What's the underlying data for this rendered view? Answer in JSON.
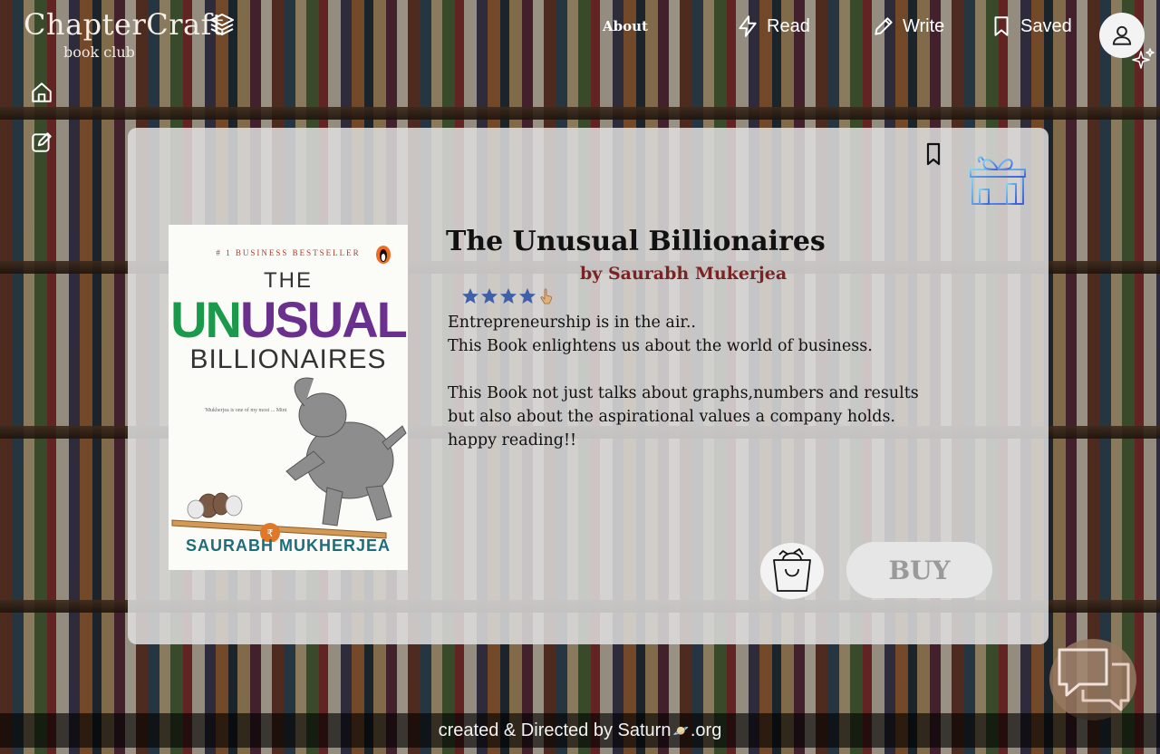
{
  "header": {
    "brand": "ChapterCraft",
    "brand_sub": "book club",
    "nav": {
      "about": "About",
      "read": "Read",
      "write": "Write",
      "saved": "Saved"
    }
  },
  "sidebar": {
    "icons": [
      "home-icon",
      "edit-icon"
    ]
  },
  "book": {
    "title": "The Unusual Billionaires",
    "author": "by Saurabh Mukerjea",
    "rating": 4,
    "rating_max": 5,
    "description": "Entrepreneurship is in the air..\nThis Book enlightens us about the world of business.\n\nThis Book not just talks about graphs,numbers and results\nbut also about the aspirational values a company holds.\nhappy reading!!",
    "cover": {
      "tag": "# 1 BUSINESS BESTSELLER",
      "the": "THE",
      "unusual_green": "UN",
      "unusual_purple": "USUAL",
      "billionaires": "BILLIONAIRES",
      "quote": "'Mukherjea is one of my most ... Mint",
      "author": "SAURABH MUKHERJEA"
    }
  },
  "actions": {
    "buy_label": "BUY"
  },
  "footer": {
    "text_before": "created & Directed by Saturn",
    "text_after": ".org"
  },
  "colors": {
    "author": "#7a2323",
    "card_bg": "#dedede",
    "star": "#3f5fa8",
    "cover_green": "#1c9a4b",
    "cover_purple": "#6b2f8d"
  }
}
